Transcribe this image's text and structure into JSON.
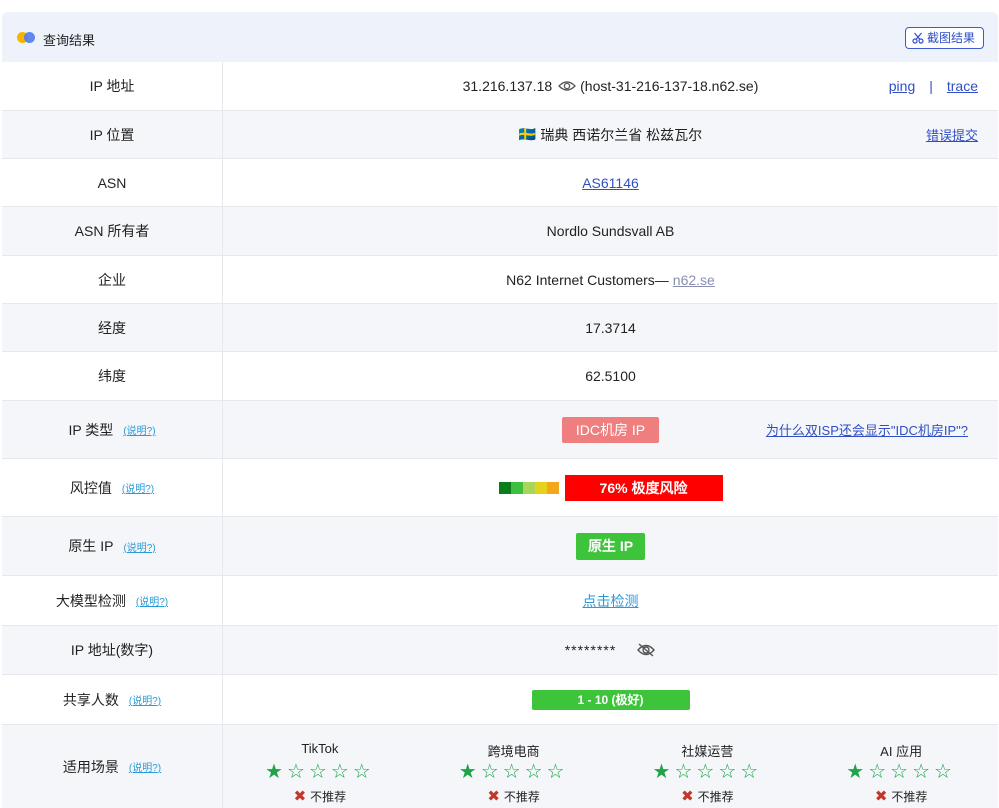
{
  "header": {
    "title": "查询结果",
    "screenshot_btn": "截图结果"
  },
  "rows": {
    "ip": {
      "label": "IP 地址",
      "value": "31.216.137.18",
      "host": "(host-31-216-137-18.n62.se)",
      "ping": "ping",
      "sep": "|",
      "trace": "trace"
    },
    "location": {
      "label": "IP 位置",
      "flag": "🇸🇪",
      "value": "瑞典 西诺尔兰省 松兹瓦尔",
      "report": "错误提交"
    },
    "asn": {
      "label": "ASN",
      "value": "AS61146"
    },
    "asn_owner": {
      "label": "ASN 所有者",
      "value": "Nordlo Sundsvall AB"
    },
    "company": {
      "label": "企业",
      "value": "N62 Internet Customers—",
      "domain": "n62.se"
    },
    "longitude": {
      "label": "经度",
      "value": "17.3714"
    },
    "latitude": {
      "label": "纬度",
      "value": "62.5100"
    },
    "ip_type": {
      "label": "IP 类型",
      "help": "(说明?)",
      "value": "IDC机房 IP",
      "why": "为什么双ISP还会显示\"IDC机房IP\"?"
    },
    "risk": {
      "label": "风控值",
      "help": "(说明?)",
      "value": "76%  极度风险",
      "scale_colors": [
        "#0a7d1a",
        "#3fbf3f",
        "#a9d65a",
        "#e6d21a",
        "#f2a81a"
      ]
    },
    "native": {
      "label": "原生 IP",
      "help": "(说明?)",
      "value": "原生 IP"
    },
    "llm": {
      "label": "大模型检测",
      "help": "(说明?)",
      "value": "点击检测"
    },
    "ip_number": {
      "label": "IP 地址(数字)",
      "value": "********"
    },
    "shared": {
      "label": "共享人数",
      "help": "(说明?)",
      "value": "1 - 10 (极好)"
    },
    "scenes": {
      "label": "适用场景",
      "help": "(说明?)",
      "items": [
        {
          "name": "TikTok",
          "stars": "★☆☆☆☆",
          "rec": "不推荐"
        },
        {
          "name": "跨境电商",
          "stars": "★☆☆☆☆",
          "rec": "不推荐"
        },
        {
          "name": "社媒运营",
          "stars": "★☆☆☆☆",
          "rec": "不推荐"
        },
        {
          "name": "AI 应用",
          "stars": "★☆☆☆☆",
          "rec": "不推荐"
        }
      ]
    }
  },
  "colors": {
    "accent": "#2f4fc7",
    "idc_badge": "#ef7f7f",
    "risk_red": "#ff0000",
    "native_green": "#3ec43b",
    "star_green": "#22a34a"
  }
}
